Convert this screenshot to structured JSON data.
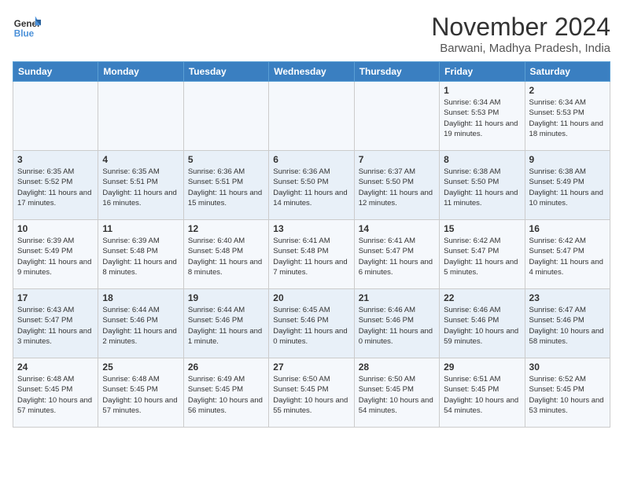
{
  "logo": {
    "line1": "General",
    "line2": "Blue"
  },
  "title": "November 2024",
  "location": "Barwani, Madhya Pradesh, India",
  "days_of_week": [
    "Sunday",
    "Monday",
    "Tuesday",
    "Wednesday",
    "Thursday",
    "Friday",
    "Saturday"
  ],
  "weeks": [
    [
      {
        "day": "",
        "info": ""
      },
      {
        "day": "",
        "info": ""
      },
      {
        "day": "",
        "info": ""
      },
      {
        "day": "",
        "info": ""
      },
      {
        "day": "",
        "info": ""
      },
      {
        "day": "1",
        "info": "Sunrise: 6:34 AM\nSunset: 5:53 PM\nDaylight: 11 hours and 19 minutes."
      },
      {
        "day": "2",
        "info": "Sunrise: 6:34 AM\nSunset: 5:53 PM\nDaylight: 11 hours and 18 minutes."
      }
    ],
    [
      {
        "day": "3",
        "info": "Sunrise: 6:35 AM\nSunset: 5:52 PM\nDaylight: 11 hours and 17 minutes."
      },
      {
        "day": "4",
        "info": "Sunrise: 6:35 AM\nSunset: 5:51 PM\nDaylight: 11 hours and 16 minutes."
      },
      {
        "day": "5",
        "info": "Sunrise: 6:36 AM\nSunset: 5:51 PM\nDaylight: 11 hours and 15 minutes."
      },
      {
        "day": "6",
        "info": "Sunrise: 6:36 AM\nSunset: 5:50 PM\nDaylight: 11 hours and 14 minutes."
      },
      {
        "day": "7",
        "info": "Sunrise: 6:37 AM\nSunset: 5:50 PM\nDaylight: 11 hours and 12 minutes."
      },
      {
        "day": "8",
        "info": "Sunrise: 6:38 AM\nSunset: 5:50 PM\nDaylight: 11 hours and 11 minutes."
      },
      {
        "day": "9",
        "info": "Sunrise: 6:38 AM\nSunset: 5:49 PM\nDaylight: 11 hours and 10 minutes."
      }
    ],
    [
      {
        "day": "10",
        "info": "Sunrise: 6:39 AM\nSunset: 5:49 PM\nDaylight: 11 hours and 9 minutes."
      },
      {
        "day": "11",
        "info": "Sunrise: 6:39 AM\nSunset: 5:48 PM\nDaylight: 11 hours and 8 minutes."
      },
      {
        "day": "12",
        "info": "Sunrise: 6:40 AM\nSunset: 5:48 PM\nDaylight: 11 hours and 8 minutes."
      },
      {
        "day": "13",
        "info": "Sunrise: 6:41 AM\nSunset: 5:48 PM\nDaylight: 11 hours and 7 minutes."
      },
      {
        "day": "14",
        "info": "Sunrise: 6:41 AM\nSunset: 5:47 PM\nDaylight: 11 hours and 6 minutes."
      },
      {
        "day": "15",
        "info": "Sunrise: 6:42 AM\nSunset: 5:47 PM\nDaylight: 11 hours and 5 minutes."
      },
      {
        "day": "16",
        "info": "Sunrise: 6:42 AM\nSunset: 5:47 PM\nDaylight: 11 hours and 4 minutes."
      }
    ],
    [
      {
        "day": "17",
        "info": "Sunrise: 6:43 AM\nSunset: 5:47 PM\nDaylight: 11 hours and 3 minutes."
      },
      {
        "day": "18",
        "info": "Sunrise: 6:44 AM\nSunset: 5:46 PM\nDaylight: 11 hours and 2 minutes."
      },
      {
        "day": "19",
        "info": "Sunrise: 6:44 AM\nSunset: 5:46 PM\nDaylight: 11 hours and 1 minute."
      },
      {
        "day": "20",
        "info": "Sunrise: 6:45 AM\nSunset: 5:46 PM\nDaylight: 11 hours and 0 minutes."
      },
      {
        "day": "21",
        "info": "Sunrise: 6:46 AM\nSunset: 5:46 PM\nDaylight: 11 hours and 0 minutes."
      },
      {
        "day": "22",
        "info": "Sunrise: 6:46 AM\nSunset: 5:46 PM\nDaylight: 10 hours and 59 minutes."
      },
      {
        "day": "23",
        "info": "Sunrise: 6:47 AM\nSunset: 5:46 PM\nDaylight: 10 hours and 58 minutes."
      }
    ],
    [
      {
        "day": "24",
        "info": "Sunrise: 6:48 AM\nSunset: 5:45 PM\nDaylight: 10 hours and 57 minutes."
      },
      {
        "day": "25",
        "info": "Sunrise: 6:48 AM\nSunset: 5:45 PM\nDaylight: 10 hours and 57 minutes."
      },
      {
        "day": "26",
        "info": "Sunrise: 6:49 AM\nSunset: 5:45 PM\nDaylight: 10 hours and 56 minutes."
      },
      {
        "day": "27",
        "info": "Sunrise: 6:50 AM\nSunset: 5:45 PM\nDaylight: 10 hours and 55 minutes."
      },
      {
        "day": "28",
        "info": "Sunrise: 6:50 AM\nSunset: 5:45 PM\nDaylight: 10 hours and 54 minutes."
      },
      {
        "day": "29",
        "info": "Sunrise: 6:51 AM\nSunset: 5:45 PM\nDaylight: 10 hours and 54 minutes."
      },
      {
        "day": "30",
        "info": "Sunrise: 6:52 AM\nSunset: 5:45 PM\nDaylight: 10 hours and 53 minutes."
      }
    ]
  ]
}
